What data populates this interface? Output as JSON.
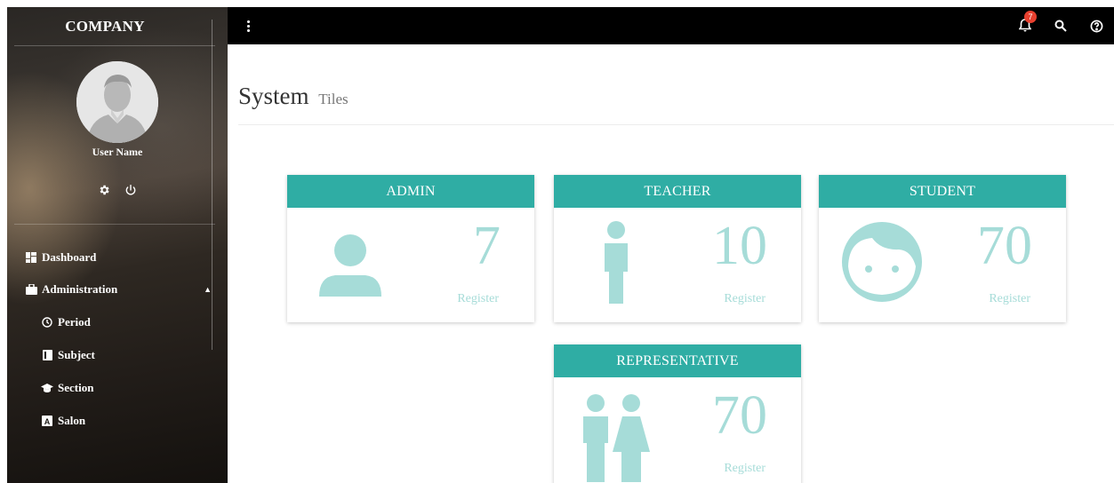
{
  "sidebar": {
    "company": "COMPANY",
    "user_name": "User Name",
    "nav": [
      {
        "label": "Dashboard",
        "icon": "dashboard-icon"
      },
      {
        "label": "Administration",
        "icon": "briefcase-icon"
      }
    ],
    "sub_nav": [
      {
        "label": "Period",
        "icon": "clock-icon"
      },
      {
        "label": "Subject",
        "icon": "book-icon"
      },
      {
        "label": "Section",
        "icon": "graduation-cap-icon"
      },
      {
        "label": "Salon",
        "icon": "letter-a-icon"
      }
    ]
  },
  "topbar": {
    "notification_count": "7",
    "icons": [
      "notification-bell-icon",
      "search-icon",
      "help-icon"
    ]
  },
  "header": {
    "title": "System",
    "subtitle": "Tiles"
  },
  "tiles": [
    {
      "title": "ADMIN",
      "count": "7",
      "label": "Register",
      "icon": "person-icon"
    },
    {
      "title": "TEACHER",
      "count": "10",
      "label": "Register",
      "icon": "standing-person-icon"
    },
    {
      "title": "STUDENT",
      "count": "70",
      "label": "Register",
      "icon": "child-face-icon"
    },
    {
      "title": "REPRESENTATIVE",
      "count": "70",
      "label": "Register",
      "icon": "parents-icon"
    }
  ],
  "colors": {
    "accent": "#2fada4",
    "tile_value": "#a6dcd8",
    "badge": "#e8402f",
    "topbar": "#000000"
  }
}
